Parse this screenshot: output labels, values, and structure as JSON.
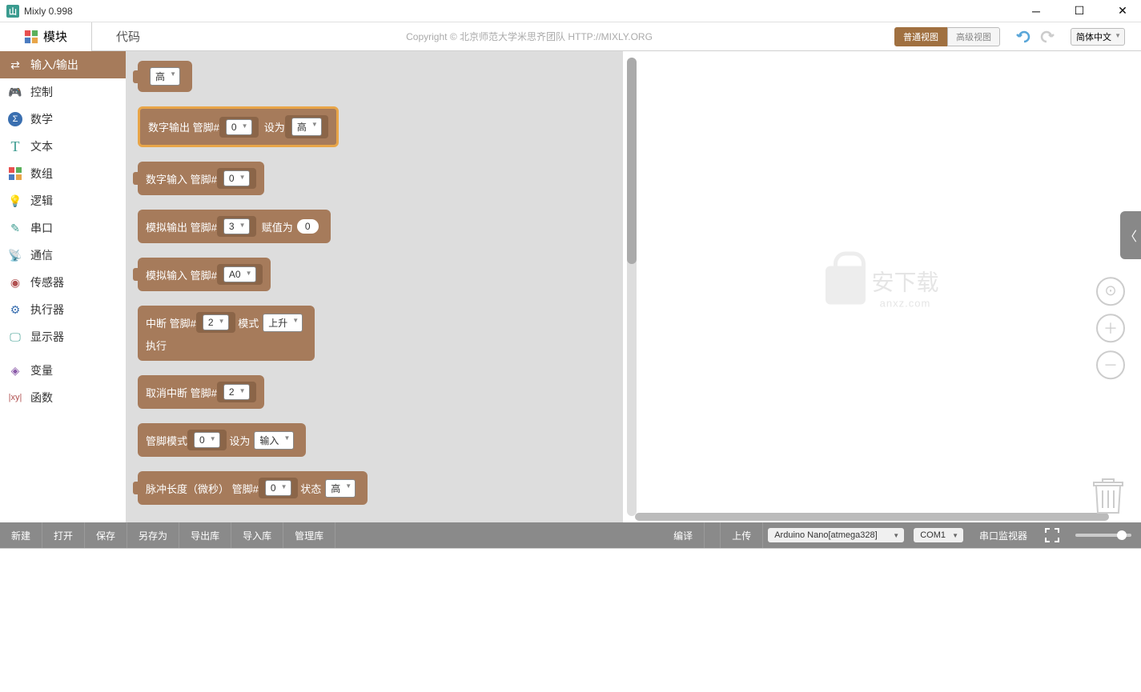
{
  "app": {
    "title": "Mixly 0.998",
    "icon_letter": "山"
  },
  "tabs": {
    "module": "模块",
    "code": "代码"
  },
  "copyright": "Copyright  ©  北京师范大学米思齐团队 HTTP://MIXLY.ORG",
  "views": {
    "normal": "普通视图",
    "advanced": "高级视图"
  },
  "language": "简体中文",
  "sidebar": [
    {
      "label": "输入/输出",
      "color": "#fff",
      "active": true,
      "icon": "io"
    },
    {
      "label": "控制",
      "color": "#5ba55b",
      "icon": "gamepad"
    },
    {
      "label": "数学",
      "color": "#3a6fb0",
      "icon": "sigma"
    },
    {
      "label": "文本",
      "color": "#3a9b8f",
      "icon": "T"
    },
    {
      "label": "数组",
      "color": "#b05050",
      "icon": "grid"
    },
    {
      "label": "逻辑",
      "color": "#3a6fb0",
      "icon": "bulb"
    },
    {
      "label": "串口",
      "color": "#3a9b8f",
      "icon": "pen"
    },
    {
      "label": "通信",
      "color": "#5ba55b",
      "icon": "sat"
    },
    {
      "label": "传感器",
      "color": "#b05050",
      "icon": "sensor"
    },
    {
      "label": "执行器",
      "color": "#3a6fb0",
      "icon": "motor"
    },
    {
      "label": "显示器",
      "color": "#3a9b8f",
      "icon": "monitor"
    },
    {
      "label": "变量",
      "color": "#8a5aa8",
      "icon": "cube"
    },
    {
      "label": "函数",
      "color": "#b05050",
      "icon": "fx"
    }
  ],
  "blocks": {
    "b0_high": "高",
    "b1": {
      "t1": "数字输出",
      "t2": "管脚#",
      "pin": "0",
      "t3": "设为",
      "val": "高"
    },
    "b2": {
      "t1": "数字输入",
      "t2": "管脚#",
      "pin": "0"
    },
    "b3": {
      "t1": "模拟输出",
      "t2": "管脚#",
      "pin": "3",
      "t3": "赋值为",
      "val": "0"
    },
    "b4": {
      "t1": "模拟输入",
      "t2": "管脚#",
      "pin": "A0"
    },
    "b5": {
      "t1": "中断",
      "t2": "管脚#",
      "pin": "2",
      "t3": "模式",
      "mode": "上升",
      "exec": "执行"
    },
    "b6": {
      "t1": "取消中断",
      "t2": "管脚#",
      "pin": "2"
    },
    "b7": {
      "t1": "管脚模式",
      "pin": "0",
      "t2": "设为",
      "mode": "输入"
    },
    "b8": {
      "t1": "脉冲长度（微秒）",
      "t2": "管脚#",
      "pin": "0",
      "t3": "状态",
      "state": "高"
    }
  },
  "watermark": {
    "t1": "安下载",
    "t2": "anxz.com"
  },
  "toolbar": {
    "new": "新建",
    "open": "打开",
    "save": "保存",
    "saveas": "另存为",
    "export": "导出库",
    "import": "导入库",
    "manage": "管理库",
    "compile": "编译",
    "upload": "上传",
    "board": "Arduino Nano[atmega328]",
    "port": "COM1",
    "serial": "串口监视器"
  }
}
